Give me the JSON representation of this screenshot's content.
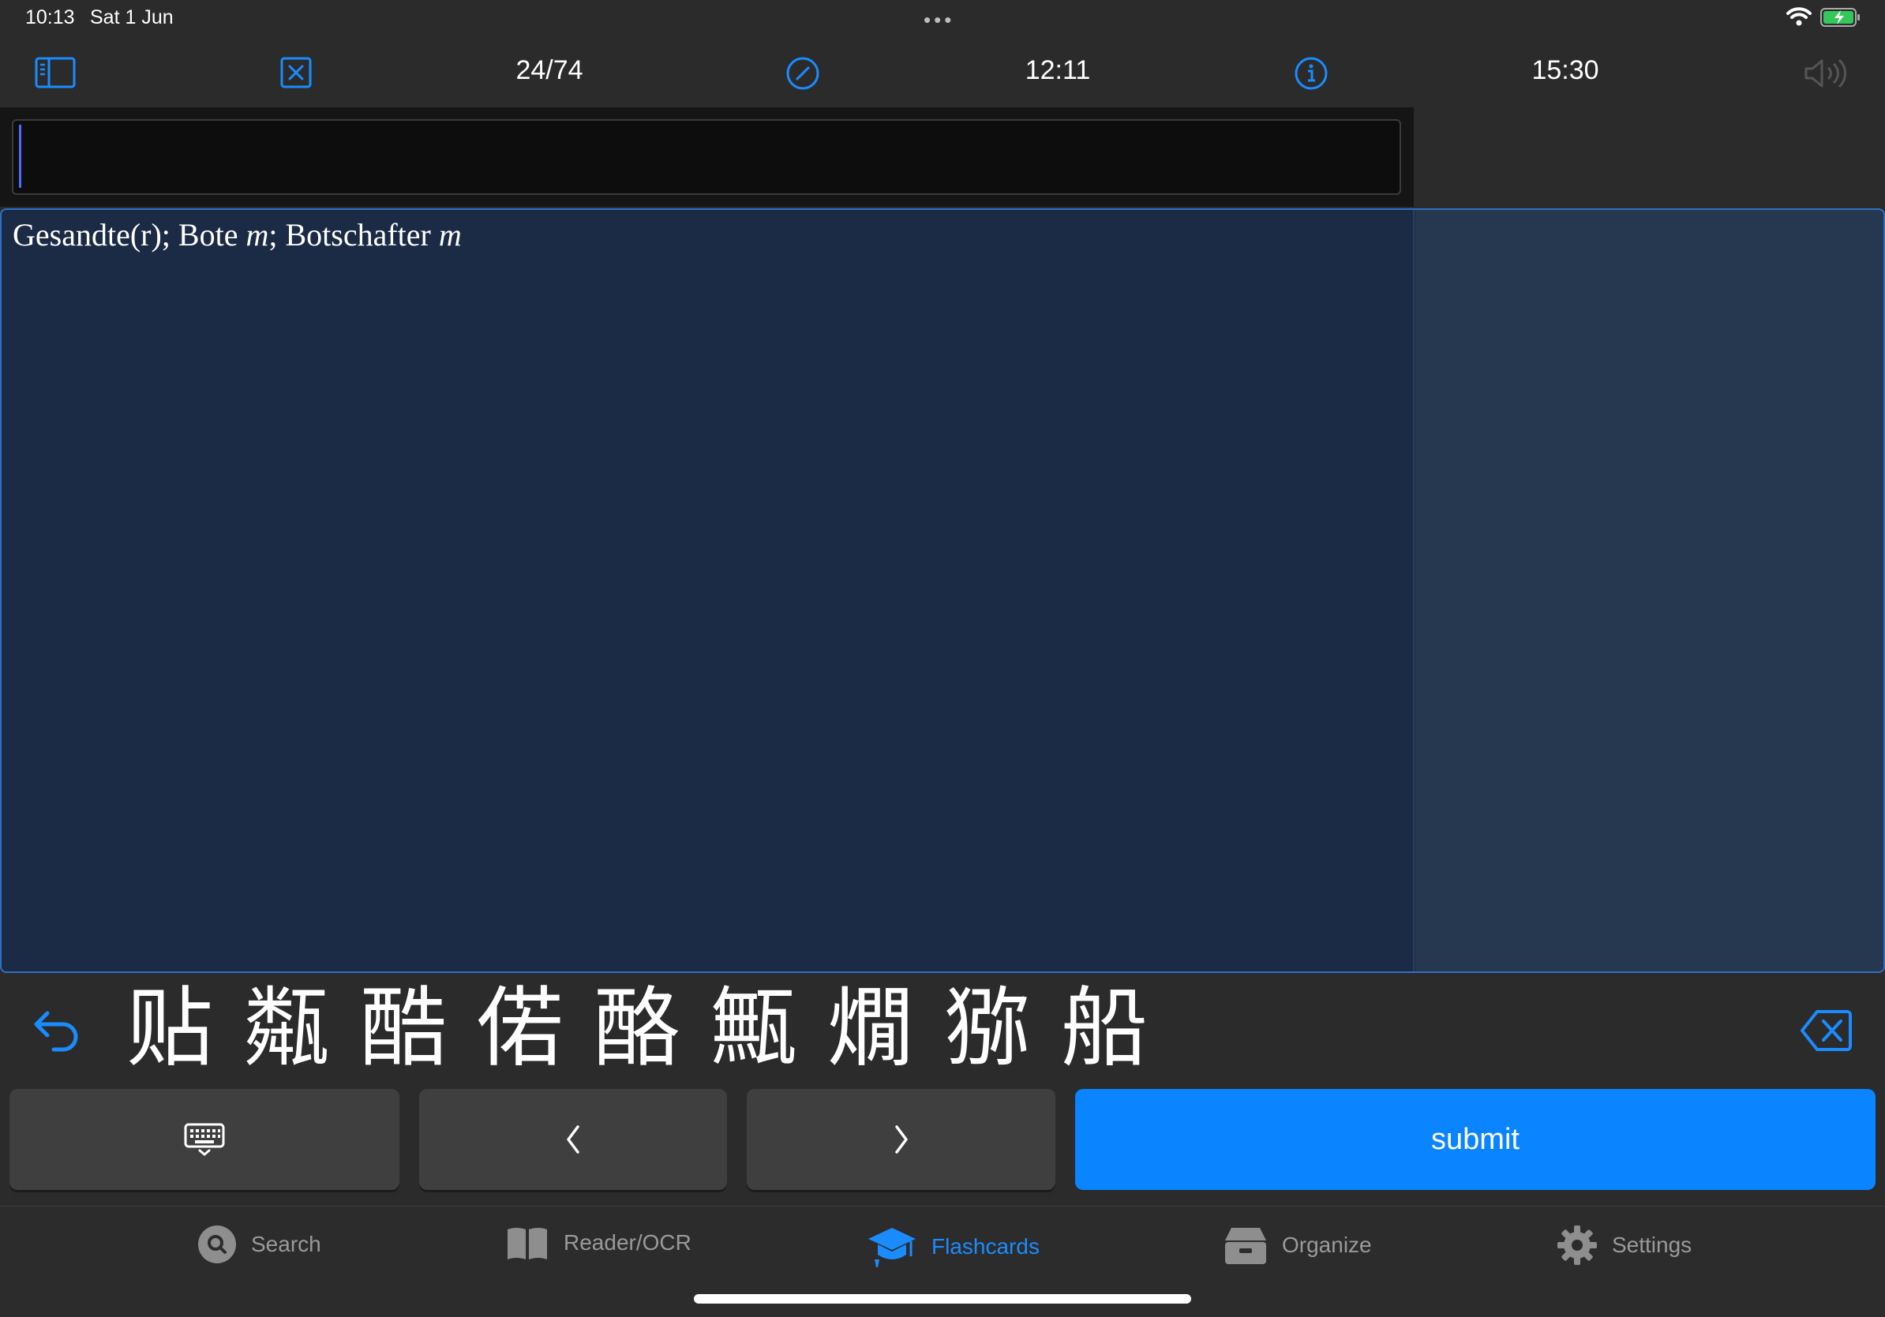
{
  "status_bar": {
    "time": "10:13",
    "date": "Sat 1 Jun",
    "dots": "•••"
  },
  "toolbar": {
    "progress": "24/74",
    "time_left": "12:11",
    "time_right": "15:30",
    "icons": [
      "sidebar-icon",
      "close-square-icon",
      "slash-circle-icon",
      "info-icon",
      "speaker-icon"
    ]
  },
  "input": {
    "value": ""
  },
  "card": {
    "definition_parts": [
      {
        "text": "Gesandte(r); Bote ",
        "italic": false
      },
      {
        "text": "m",
        "italic": true
      },
      {
        "text": "; Botschafter ",
        "italic": false
      },
      {
        "text": "m",
        "italic": true
      }
    ]
  },
  "candidates": [
    "贴",
    "甐",
    "酷",
    "偌",
    "酪",
    "甒",
    "燗",
    "猕",
    "船"
  ],
  "buttons": {
    "submit": "submit"
  },
  "tabs": [
    {
      "label": "Search",
      "icon": "search-icon"
    },
    {
      "label": "Reader/OCR",
      "icon": "book-icon"
    },
    {
      "label": "Flashcards",
      "icon": "graduation-cap-icon",
      "active": true
    },
    {
      "label": "Organize",
      "icon": "tray-icon"
    },
    {
      "label": "Settings",
      "icon": "gear-icon"
    }
  ],
  "colors": {
    "accent": "#0a84ff",
    "card_bg": "#1b2b45",
    "card_border": "#2f6fc4"
  }
}
